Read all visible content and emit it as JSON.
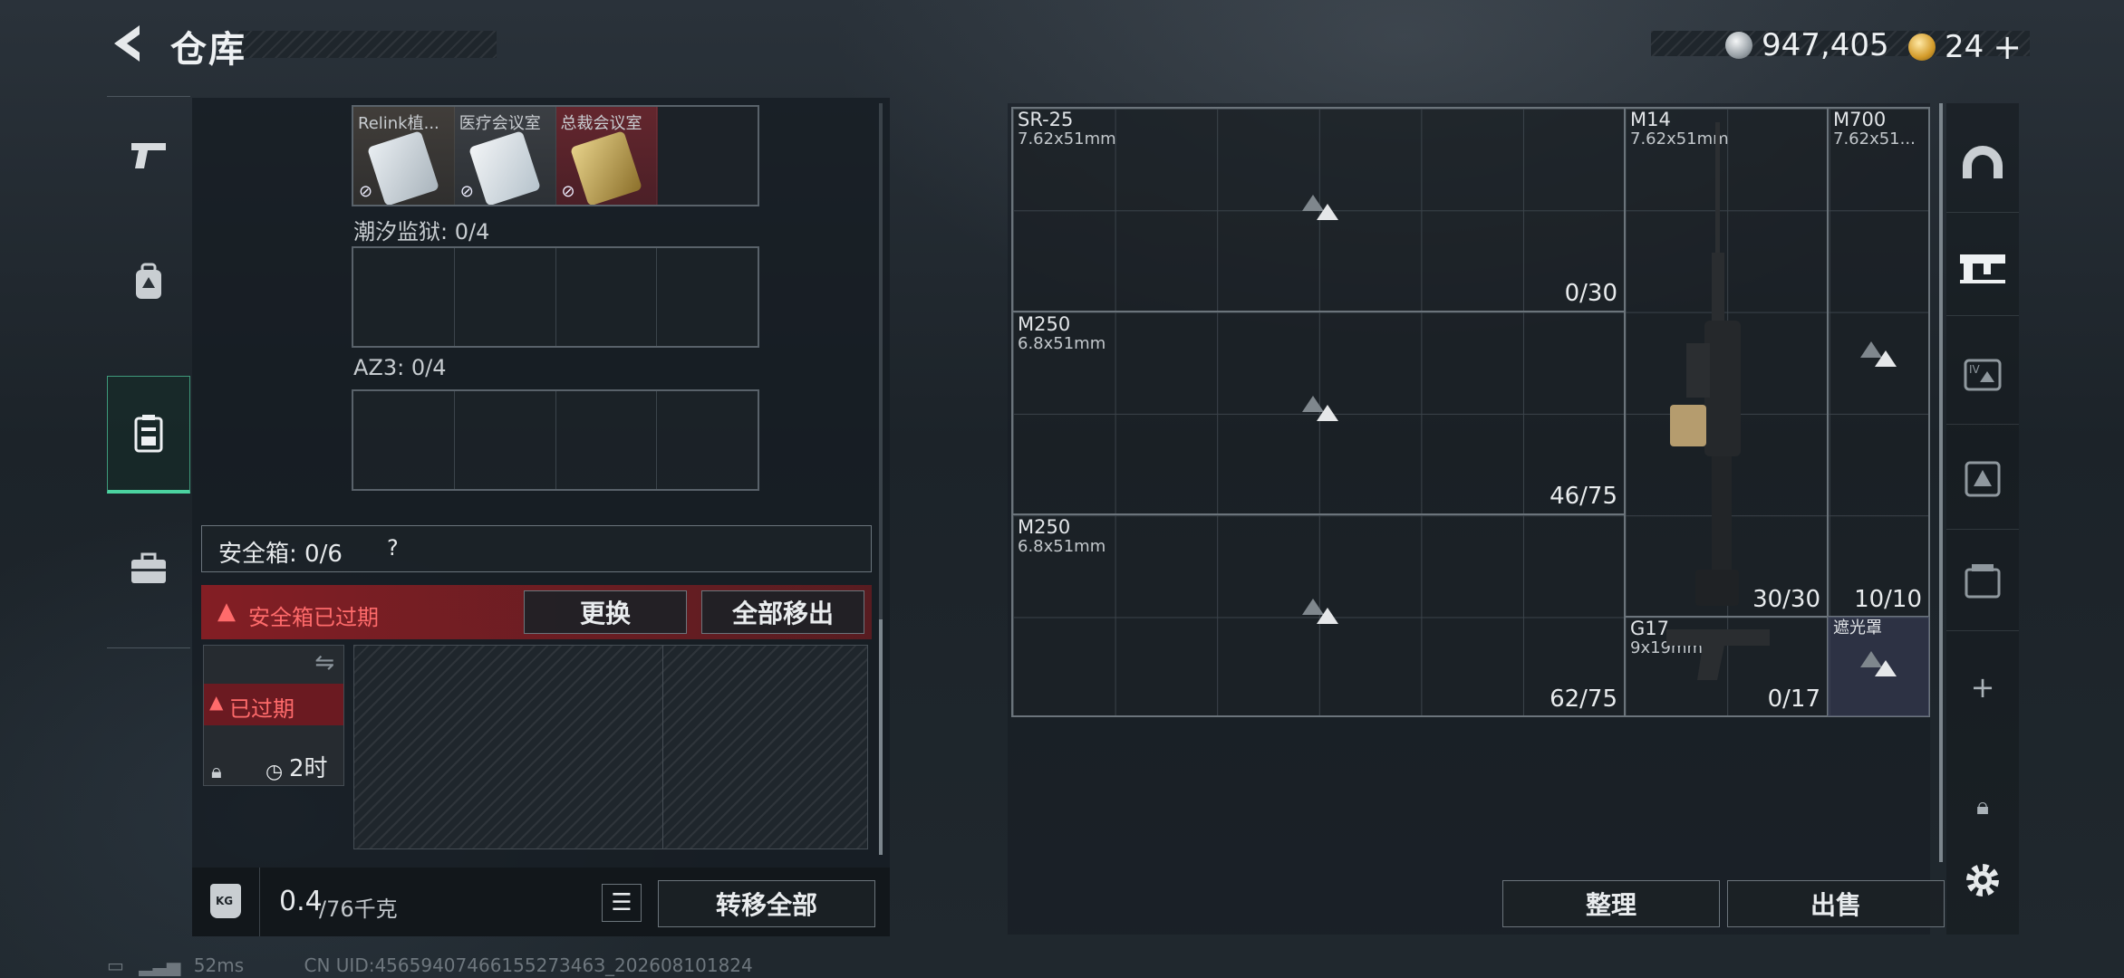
{
  "header": {
    "title": "仓库",
    "currency_silver": "947,405",
    "currency_gold": "24",
    "currency_add": "+"
  },
  "left_sidebar": {
    "items": [
      {
        "icon": "pistol-icon"
      },
      {
        "icon": "backpack-icon"
      },
      {
        "icon": "keycard-case-icon",
        "active": true
      },
      {
        "icon": "briefcase-icon"
      }
    ]
  },
  "key_cards": [
    "Relink植...",
    "医疗会议室",
    "总裁会议室"
  ],
  "sections": [
    {
      "label": "潮汐监狱: 0/4"
    },
    {
      "label": "AZ3: 0/4"
    }
  ],
  "safe_box": {
    "label": "安全箱:  0/6",
    "help": "?",
    "warning": "安全箱已过期",
    "replace_button": "更换",
    "remove_all_button": "全部移出",
    "expired_tag": "已过期",
    "timer": "2时"
  },
  "weight": {
    "current": "0.4",
    "max": "/76千克",
    "kg_label": "KG",
    "transfer_button": "转移全部"
  },
  "stash": {
    "slots": [
      {
        "name": "SR-25",
        "caliber": "7.62x51mm",
        "count": "0/30"
      },
      {
        "name": "M250",
        "caliber": "6.8x51mm",
        "count": "46/75"
      },
      {
        "name": "M250",
        "caliber": "6.8x51mm",
        "count": "62/75"
      },
      {
        "name": "M14",
        "caliber": "7.62x51mm",
        "count": "30/30"
      },
      {
        "name": "M700",
        "caliber": "7.62x51...",
        "count": "10/10"
      },
      {
        "name": "G17",
        "caliber": "9x19mm",
        "count": "0/17"
      },
      {
        "name": "遮光罩",
        "caliber": "",
        "count": ""
      }
    ],
    "sort_button": "整理",
    "sell_button": "出售"
  },
  "right_sidebar": {
    "icons": [
      "helmet-icon",
      "rifle-rack-icon",
      "armor-icon",
      "vest-icon",
      "container-icon",
      "add-icon",
      "lock-icon",
      "settings-icon"
    ],
    "add": "+"
  },
  "footer": {
    "ping": "52ms",
    "uid": "CN UID:4565940746615527346З_202608101824"
  },
  "colors": {
    "accent": "#4bd3a0",
    "warning": "#e04a4a",
    "panel": "#1a2026"
  }
}
